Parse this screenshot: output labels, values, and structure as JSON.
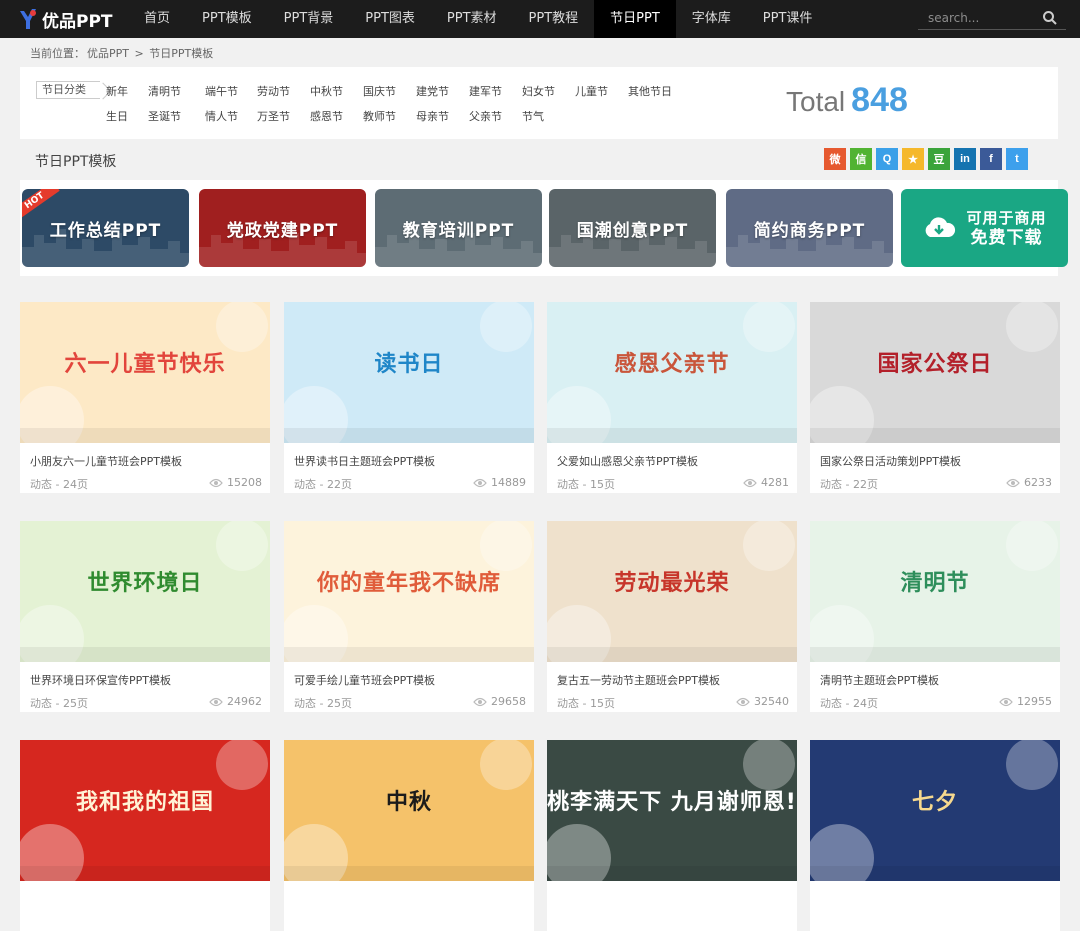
{
  "site": {
    "logo_text": "优品PPT"
  },
  "nav": {
    "items": [
      "首页",
      "PPT模板",
      "PPT背景",
      "PPT图表",
      "PPT素材",
      "PPT教程",
      "节日PPT",
      "字体库",
      "PPT课件"
    ],
    "active_index": 6
  },
  "search": {
    "placeholder": "search..."
  },
  "breadcrumb": {
    "prefix": "当前位置：",
    "home": "优品PPT",
    "sep": ">",
    "current": "节日PPT模板"
  },
  "filter": {
    "label": "节日分类",
    "row1": [
      "新年",
      "清明节",
      "端午节",
      "劳动节",
      "中秋节",
      "国庆节",
      "建党节",
      "建军节",
      "妇女节",
      "儿童节",
      "其他节日"
    ],
    "row2": [
      "生日",
      "圣诞节",
      "情人节",
      "万圣节",
      "感恩节",
      "教师节",
      "母亲节",
      "父亲节",
      "节气"
    ],
    "total_label": "Total",
    "total_value": "848"
  },
  "section": {
    "title": "节日PPT模板"
  },
  "share_icons": [
    {
      "name": "weibo-icon",
      "color": "#e6592f",
      "glyph": "微"
    },
    {
      "name": "wechat-icon",
      "color": "#51b332",
      "glyph": "信"
    },
    {
      "name": "qq-icon",
      "color": "#3aa0e8",
      "glyph": "Q"
    },
    {
      "name": "qzone-icon",
      "color": "#f5b82b",
      "glyph": "★"
    },
    {
      "name": "douban-icon",
      "color": "#3ba43b",
      "glyph": "豆"
    },
    {
      "name": "linkedin-icon",
      "color": "#1574b0",
      "glyph": "in"
    },
    {
      "name": "facebook-icon",
      "color": "#3b5a98",
      "glyph": "f"
    },
    {
      "name": "twitter-icon",
      "color": "#3da0ec",
      "glyph": "t"
    }
  ],
  "banners": [
    {
      "label": "工作总结PPT",
      "badge": "HOT",
      "bg": "#2d4a66"
    },
    {
      "label": "党政党建PPT",
      "bg": "#a01f1f"
    },
    {
      "label": "教育培训PPT",
      "bg": "#5d6c74"
    },
    {
      "label": "国潮创意PPT",
      "bg": "#5a6468"
    },
    {
      "label": "简约商务PPT",
      "bg": "#5f6b85"
    },
    {
      "label_line1": "可用于商用",
      "label_line2": "免费下载",
      "bg": "#1aa784"
    }
  ],
  "cards": [
    {
      "title": "小朋友六一儿童节班会PPT模板",
      "meta": "动态 - 24页",
      "views": "15208",
      "thumb_text": "六一儿童节快乐",
      "bg": "#fde9c6",
      "fg": "#e2453c"
    },
    {
      "title": "世界读书日主题班会PPT模板",
      "meta": "动态 - 22页",
      "views": "14889",
      "thumb_text": "读书日",
      "bg": "#cfeaf7",
      "fg": "#1f86c8"
    },
    {
      "title": "父爱如山感恩父亲节PPT模板",
      "meta": "动态 - 15页",
      "views": "4281",
      "thumb_text": "感恩父亲节",
      "bg": "#d9f0f3",
      "fg": "#c9553a"
    },
    {
      "title": "国家公祭日活动策划PPT模板",
      "meta": "动态 - 22页",
      "views": "6233",
      "thumb_text": "国家公祭日",
      "bg": "#d9d9d9",
      "fg": "#b3202a"
    },
    {
      "title": "世界环境日环保宣传PPT模板",
      "meta": "动态 - 25页",
      "views": "24962",
      "thumb_text": "世界环境日",
      "bg": "#e4f2d4",
      "fg": "#2f8b2f"
    },
    {
      "title": "可爱手绘儿童节班会PPT模板",
      "meta": "动态 - 25页",
      "views": "29658",
      "thumb_text": "你的童年我不缺席",
      "bg": "#fdf3dc",
      "fg": "#e05c3a"
    },
    {
      "title": "复古五一劳动节主题班会PPT模板",
      "meta": "动态 - 15页",
      "views": "32540",
      "thumb_text": "劳动最光荣",
      "bg": "#efe1cc",
      "fg": "#c7352a"
    },
    {
      "title": "清明节主题班会PPT模板",
      "meta": "动态 - 24页",
      "views": "12955",
      "thumb_text": "清明节",
      "bg": "#e7f3e8",
      "fg": "#2e8e5b"
    },
    {
      "title": "",
      "meta": "",
      "views": "",
      "thumb_text": "我和我的祖国",
      "bg": "#d6271f",
      "fg": "#fff3d6"
    },
    {
      "title": "",
      "meta": "",
      "views": "",
      "thumb_text": "中秋",
      "bg": "#f5c26a",
      "fg": "#1b1b1b"
    },
    {
      "title": "",
      "meta": "",
      "views": "",
      "thumb_text": "桃李满天下 九月谢师恩!",
      "bg": "#3a4a44",
      "fg": "#ffffff"
    },
    {
      "title": "",
      "meta": "",
      "views": "",
      "thumb_text": "七夕",
      "bg": "#233a73",
      "fg": "#f7d98e"
    }
  ]
}
